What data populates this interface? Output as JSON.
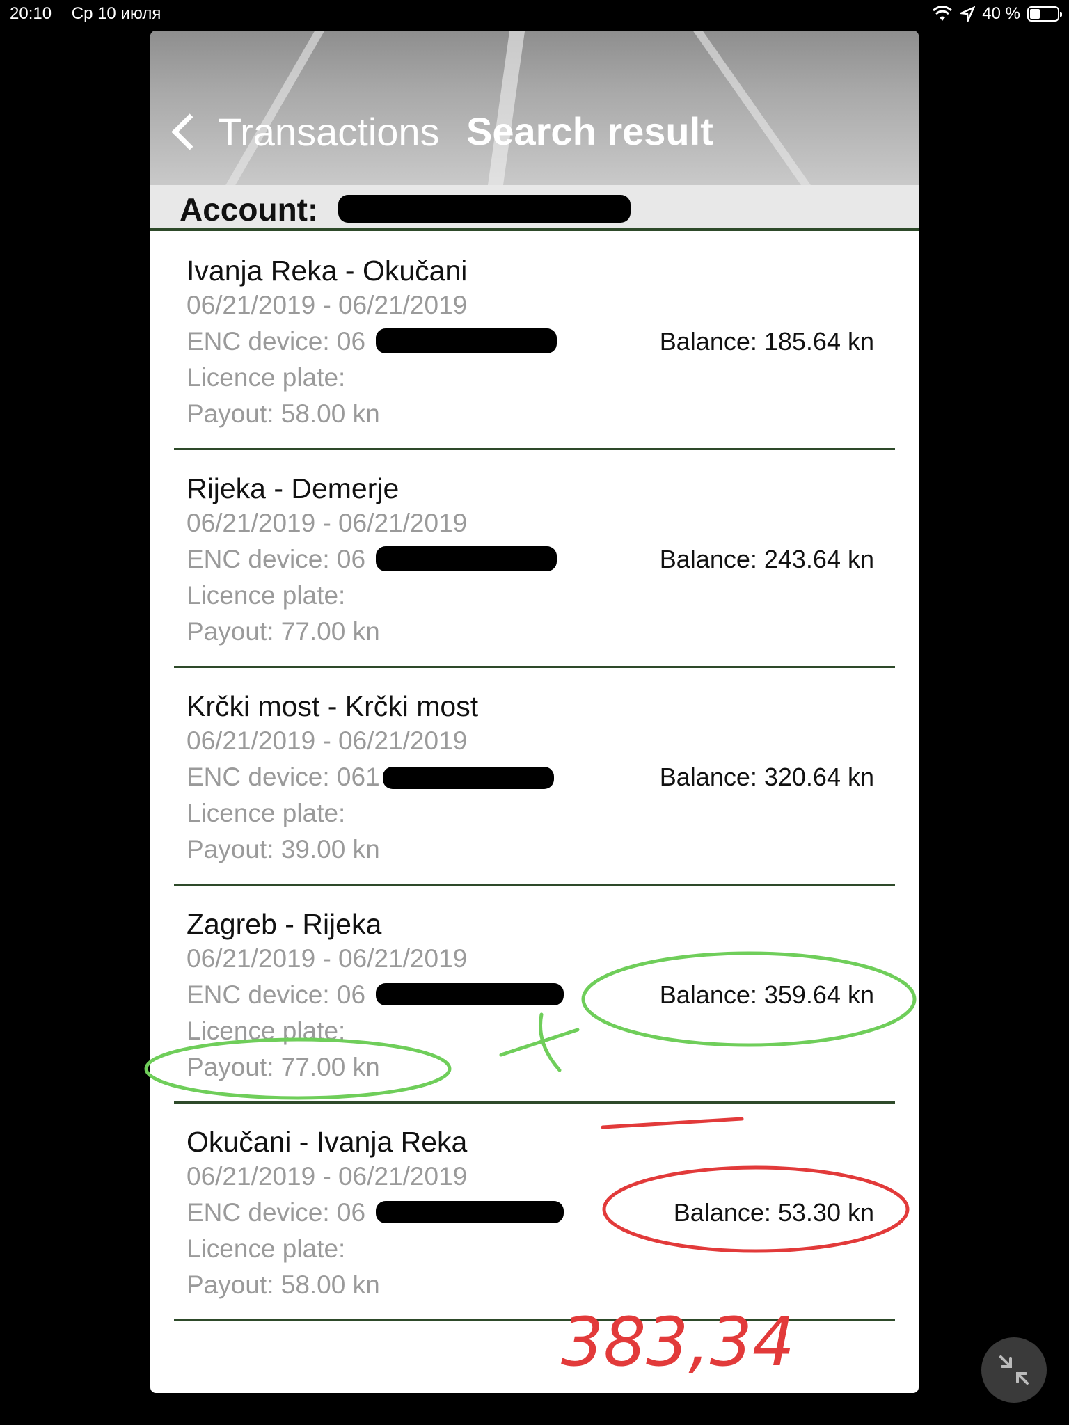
{
  "status_bar": {
    "time": "20:10",
    "date": "Ср 10 июля",
    "battery": "40 %"
  },
  "header": {
    "back_label": "Transactions",
    "title": "Search result"
  },
  "account": {
    "label": "Account:"
  },
  "transactions": [
    {
      "route": "Ivanja Reka - Okučani",
      "dates": "06/21/2019 - 06/21/2019",
      "enc_label": "ENC device: 06",
      "plate": "Licence plate:",
      "payout": "Payout: 58.00 kn",
      "balance": "Balance: 185.64 kn"
    },
    {
      "route": "Rijeka - Demerje",
      "dates": "06/21/2019 - 06/21/2019",
      "enc_label": "ENC device: 06",
      "plate": "Licence plate:",
      "payout": "Payout: 77.00 kn",
      "balance": "Balance: 243.64 kn"
    },
    {
      "route": "Krčki most - Krčki most",
      "dates": "06/21/2019 - 06/21/2019",
      "enc_label": "ENC device: 061",
      "plate": "Licence plate:",
      "payout": "Payout: 39.00 kn",
      "balance": "Balance: 320.64 kn"
    },
    {
      "route": "Zagreb - Rijeka",
      "dates": "06/21/2019 - 06/21/2019",
      "enc_label": "ENC device: 06",
      "plate": "Licence plate:",
      "payout": "Payout: 77.00 kn",
      "balance": "Balance: 359.64 kn"
    },
    {
      "route": "Okučani - Ivanja Reka",
      "dates": "06/21/2019 - 06/21/2019",
      "enc_label": "ENC device: 06",
      "plate": "Licence plate:",
      "payout": "Payout: 58.00 kn",
      "balance": "Balance: 53.30 kn"
    }
  ],
  "annotations": {
    "handwritten_total": "383,34",
    "green_color": "#6fce5a",
    "red_color": "#e23a3a"
  }
}
